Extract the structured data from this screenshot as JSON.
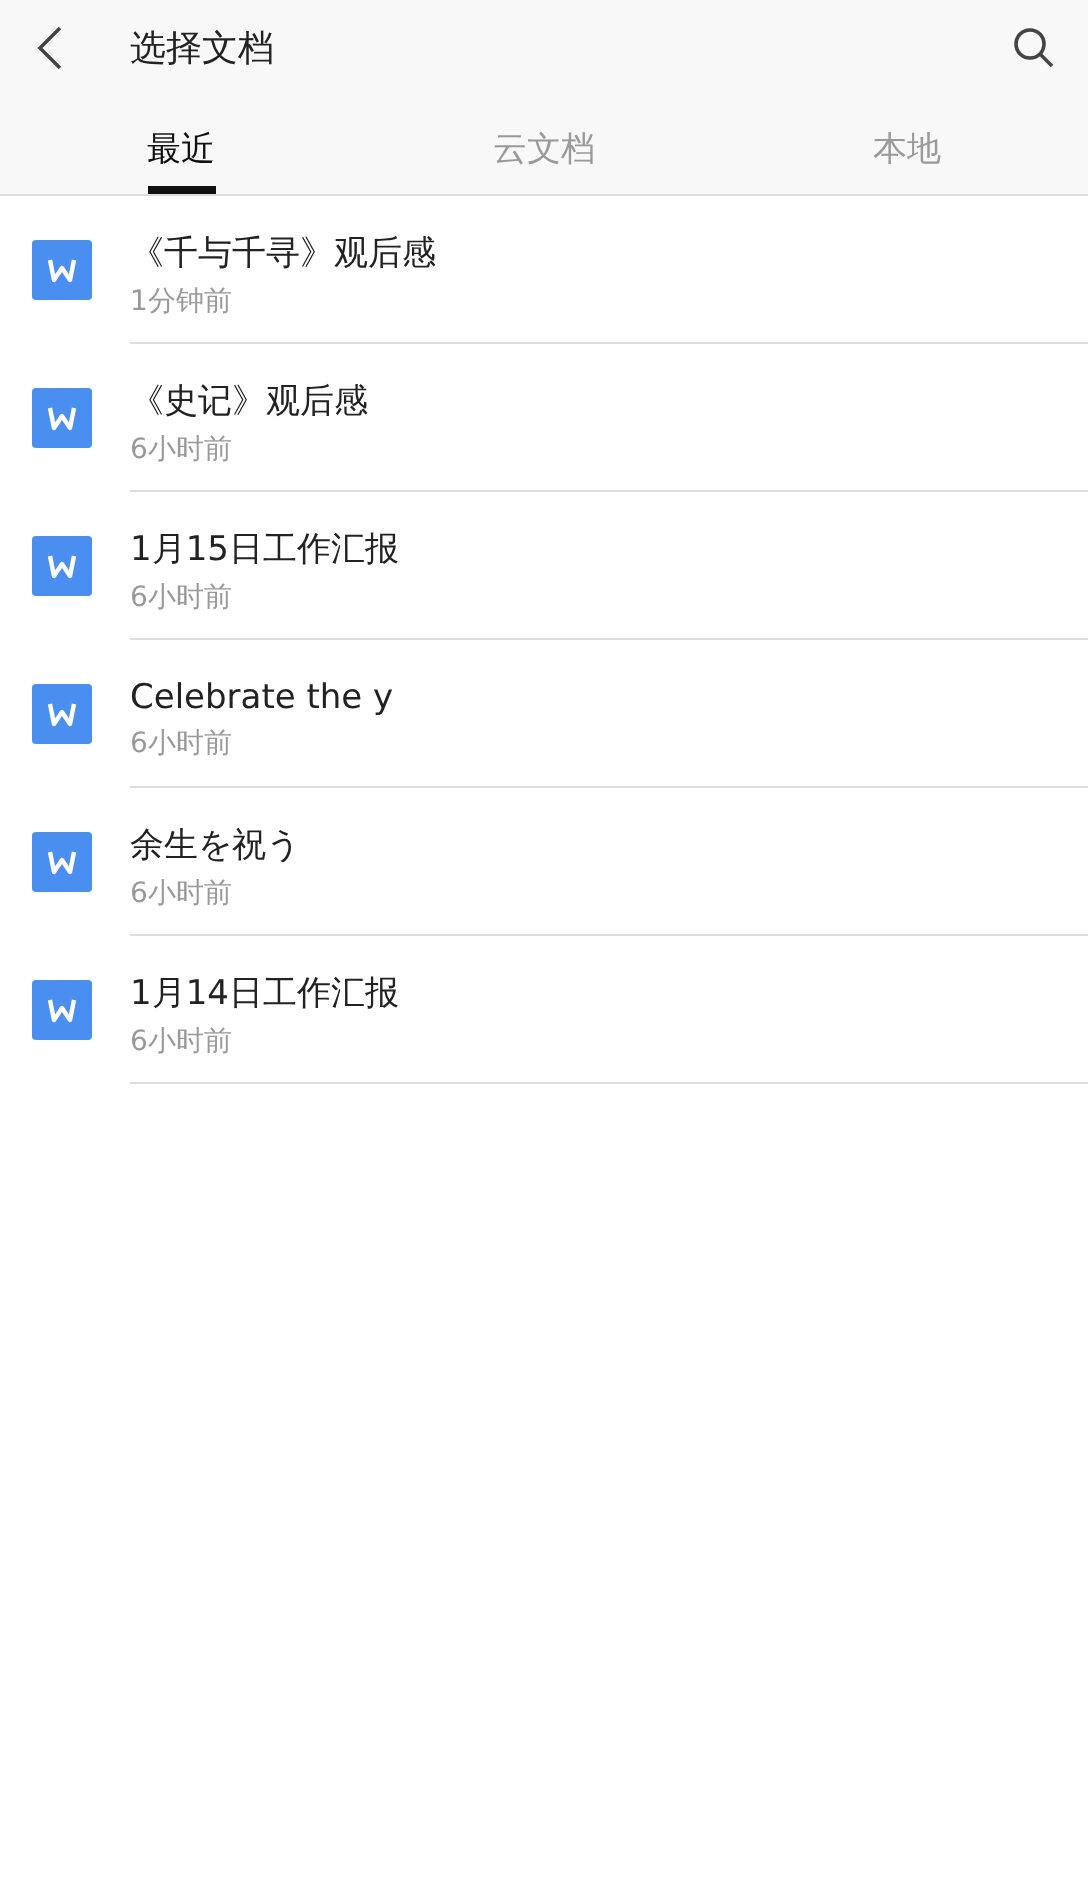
{
  "header": {
    "title": "选择文档"
  },
  "tabs": [
    {
      "label": "最近",
      "selected": true
    },
    {
      "label": "云文档",
      "selected": false
    },
    {
      "label": "本地",
      "selected": false
    }
  ],
  "documents": [
    {
      "name": "《千与千寻》观后感",
      "time": "1分钟前"
    },
    {
      "name": "《史记》观后感",
      "time": "6小时前"
    },
    {
      "name": "1月15日工作汇报",
      "time": "6小时前"
    },
    {
      "name": "Celebrate the y",
      "time": "6小时前"
    },
    {
      "name": "余生を祝う",
      "time": "6小时前"
    },
    {
      "name": "1月14日工作汇报",
      "time": "6小时前"
    }
  ]
}
